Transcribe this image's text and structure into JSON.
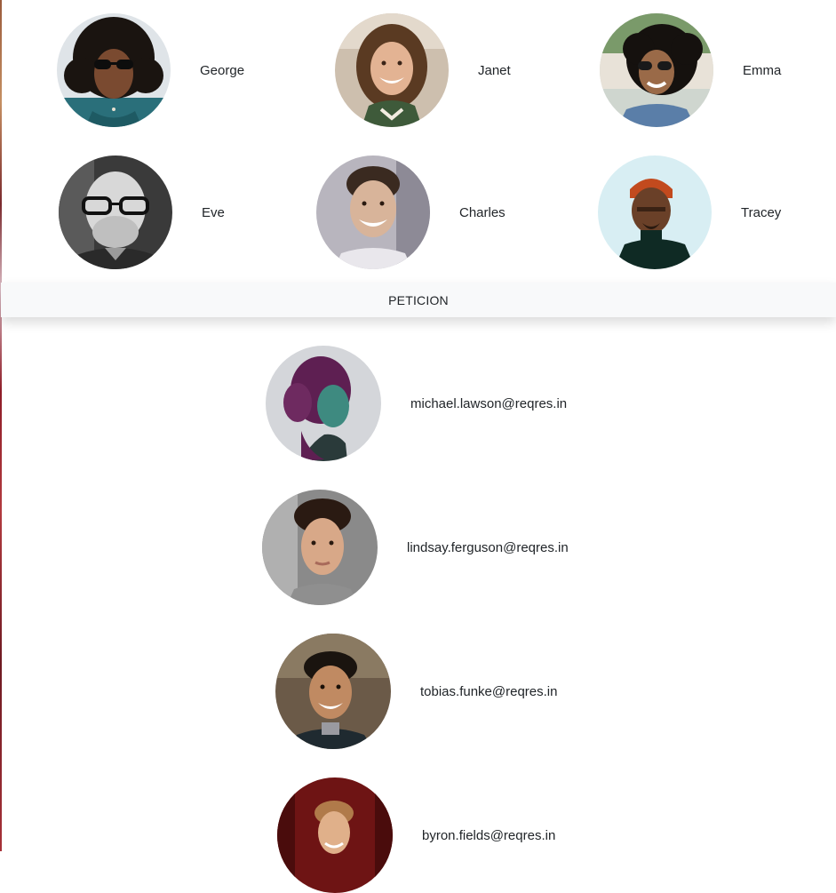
{
  "top_users": [
    {
      "name": "George",
      "avatar": "portrait-curly-hair-sunglasses"
    },
    {
      "name": "Janet",
      "avatar": "portrait-smiling-woman"
    },
    {
      "name": "Emma",
      "avatar": "portrait-curly-woman-sunglasses"
    },
    {
      "name": "Eve",
      "avatar": "portrait-bald-man-glasses"
    },
    {
      "name": "Charles",
      "avatar": "portrait-smiling-man"
    },
    {
      "name": "Tracey",
      "avatar": "portrait-man-orange-beanie"
    }
  ],
  "peticion_button": {
    "label": "PETICION"
  },
  "email_users": [
    {
      "email": "michael.lawson@reqres.in",
      "avatar": "portrait-purple-hair-woman"
    },
    {
      "email": "lindsay.ferguson@reqres.in",
      "avatar": "portrait-young-man"
    },
    {
      "email": "tobias.funke@reqres.in",
      "avatar": "portrait-smiling-young-man"
    },
    {
      "email": "byron.fields@reqres.in",
      "avatar": "portrait-man-red-background"
    }
  ],
  "colors": {
    "text": "#212529",
    "button_bg": "#f8f9fa",
    "page_bg": "#ffffff"
  }
}
